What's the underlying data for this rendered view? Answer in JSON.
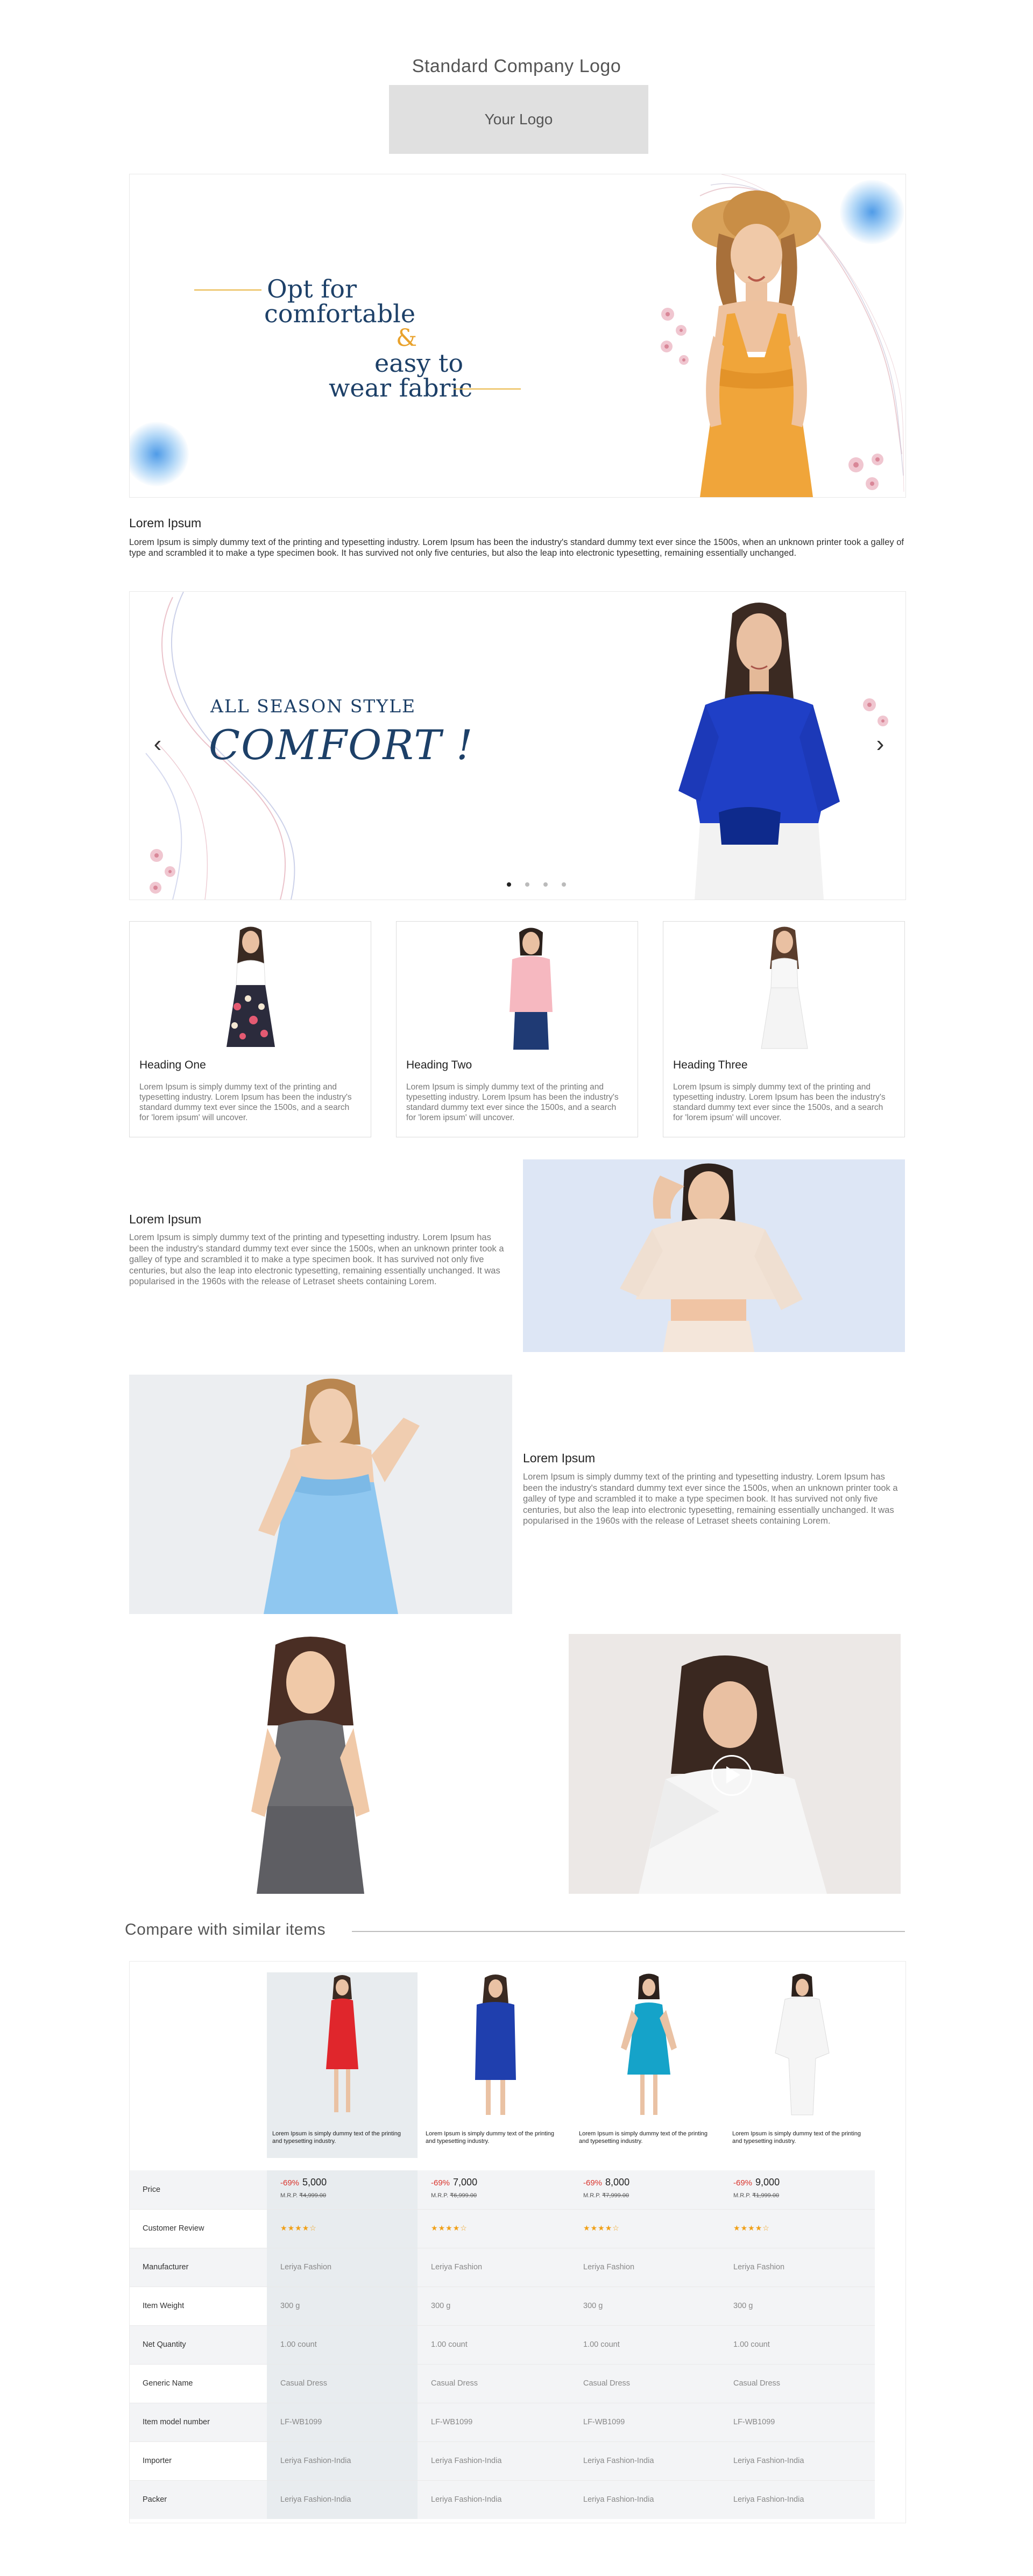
{
  "header": {
    "company_logo_title": "Standard Company Logo",
    "logo_placeholder": "Your Logo"
  },
  "hero1": {
    "line1": "Opt for",
    "line2": "comfortable",
    "amp": "&",
    "line3": "easy to",
    "line4": "wear fabric"
  },
  "intro": {
    "title": "Lorem Ipsum",
    "text": "Lorem Ipsum is simply dummy text of the printing and typesetting industry. Lorem Ipsum has been the industry's standard dummy text ever since the 1500s, when an unknown printer took a galley of type and scrambled it to make a type specimen book. It has survived not only five centuries, but also the leap into electronic typesetting, remaining essentially unchanged."
  },
  "hero2": {
    "subtitle": "ALL SEASON  STYLE",
    "title": "COMFORT !",
    "prev": "‹",
    "next": "›",
    "slides": 4,
    "active_slide": 1
  },
  "cards": [
    {
      "heading": "Heading One",
      "text": "Lorem Ipsum is simply dummy text of the printing and typesetting industry. Lorem Ipsum has been the industry's standard dummy text ever since the 1500s, and a search for 'lorem ipsum' will uncover."
    },
    {
      "heading": "Heading Two",
      "text": "Lorem Ipsum is simply dummy text of the printing and typesetting industry. Lorem Ipsum has been the industry's standard dummy text ever since the 1500s, and a search for 'lorem ipsum' will uncover."
    },
    {
      "heading": "Heading Three",
      "text": "Lorem Ipsum is simply dummy text of the printing and typesetting industry. Lorem Ipsum has been the industry's standard dummy text ever since the 1500s, and a search for 'lorem ipsum' will uncover."
    }
  ],
  "split1": {
    "title": "Lorem Ipsum",
    "text": "Lorem Ipsum is simply dummy text of the printing and typesetting industry. Lorem Ipsum has been the industry's standard dummy text ever since the 1500s, when an unknown printer took a galley of type and scrambled it to make a type specimen book. It has survived not only five centuries, but also the leap into electronic typesetting, remaining essentially unchanged. It was popularised in the 1960s with the release of Letraset sheets containing Lorem."
  },
  "split2": {
    "title": "Lorem Ipsum",
    "text": "Lorem Ipsum is simply dummy text of the printing and typesetting industry. Lorem Ipsum has been the industry's standard dummy text ever since the 1500s, when an unknown printer took a galley of type and scrambled it to make a type specimen book. It has survived not only five centuries, but also the leap into electronic typesetting, remaining essentially unchanged. It was popularised in the 1960s with the release of Letraset sheets containing Lorem."
  },
  "compare": {
    "title": "Compare with similar items",
    "product_desc": "Lorem Ipsum  is simply dummy text of the printing and typesetting industry.",
    "row_labels": {
      "price": "Price",
      "review": "Customer Review",
      "manufacturer": "Manufacturer",
      "weight": "Item Weight",
      "quantity": "Net Quantity",
      "generic": "Generic Name",
      "model": "Item model number",
      "importer": "Importer",
      "packer": "Packer"
    },
    "products": [
      {
        "discount": "-69%",
        "price": "5,000",
        "mrp_label": "M.R.P.",
        "mrp": "₹4,999.00",
        "rating": 4,
        "manufacturer": "Leriya Fashion",
        "weight": "300 g",
        "quantity": "1.00 count",
        "generic": "Casual Dress",
        "model": "LF-WB1099",
        "importer": "Leriya Fashion-India",
        "packer": "Leriya Fashion-India",
        "dress_color": "#e0262c"
      },
      {
        "discount": "-69%",
        "price": "7,000",
        "mrp_label": "M.R.P.",
        "mrp": "₹6,999.00",
        "rating": 4,
        "manufacturer": "Leriya Fashion",
        "weight": "300 g",
        "quantity": "1.00 count",
        "generic": "Casual Dress",
        "model": "LF-WB1099",
        "importer": "Leriya Fashion-India",
        "packer": "Leriya Fashion-India",
        "dress_color": "#1f3fae"
      },
      {
        "discount": "-69%",
        "price": "8,000",
        "mrp_label": "M.R.P.",
        "mrp": "₹7,999.00",
        "rating": 4,
        "manufacturer": "Leriya Fashion",
        "weight": "300 g",
        "quantity": "1.00 count",
        "generic": "Casual Dress",
        "model": "LF-WB1099",
        "importer": "Leriya Fashion-India",
        "packer": "Leriya Fashion-India",
        "dress_color": "#15a3c9"
      },
      {
        "discount": "-69%",
        "price": "9,000",
        "mrp_label": "M.R.P.",
        "mrp": "₹1,999.00",
        "rating": 4,
        "manufacturer": "Leriya Fashion",
        "weight": "300 g",
        "quantity": "1.00 count",
        "generic": "Casual Dress",
        "model": "LF-WB1099",
        "importer": "Leriya Fashion-India",
        "packer": "Leriya Fashion-India",
        "dress_color": "#f5f5f5"
      }
    ]
  },
  "colors": {
    "navy": "#1d4068",
    "gold": "#e9b645",
    "discount_red": "#d9332b",
    "star": "#f0a018"
  }
}
